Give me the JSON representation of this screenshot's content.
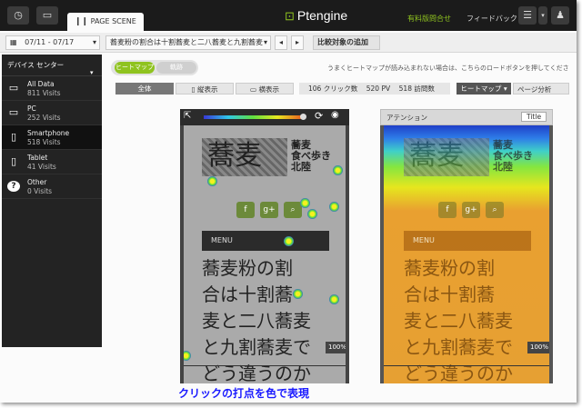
{
  "topbar": {
    "tab_label": "PAGE SCENE",
    "logo_text": "Ptengine",
    "contact_link": "有料版問合せ",
    "feedback_link": "フィードバック"
  },
  "toolbar": {
    "date_range": "07/11 - 07/17",
    "page_title": "蕎麦粉の割合は十割蕎麦と二八蕎麦と九割蕎麦",
    "compare_button": "比較対象の追加"
  },
  "sidebar": {
    "header": "デバイス センター",
    "devices": [
      {
        "name": "All Data",
        "visits": "811 Visits",
        "icon": "monitor-tablet-icon"
      },
      {
        "name": "PC",
        "visits": "252 Visits",
        "icon": "monitor-icon"
      },
      {
        "name": "Smartphone",
        "visits": "518 Visits",
        "icon": "smartphone-icon"
      },
      {
        "name": "Tablet",
        "visits": "41 Visits",
        "icon": "tablet-icon"
      },
      {
        "name": "Other",
        "visits": "0 Visits",
        "icon": "question-icon"
      }
    ]
  },
  "toggle": {
    "heatmap": "ヒートマップ",
    "trace": "軌跡"
  },
  "notice": "うまくヒートマップが読み込まれない場合は、こちらのロードボタンを押してくださ",
  "view": {
    "all": "全体",
    "portrait": "縦表示",
    "landscape": "横表示"
  },
  "stats": {
    "clicks": "106 クリック数",
    "pv": "520 PV",
    "visits": "518 訪問数"
  },
  "right_tabs": {
    "heatmap": "ヒートマップ",
    "page_analysis": "ページ分析"
  },
  "preview": {
    "kanji": "蕎麦",
    "subtitle_1": "蕎麦",
    "subtitle_2": "食べ歩き",
    "subtitle_3": "北陸",
    "menu": "MENU",
    "body_lines": [
      "蕎麦粉の割",
      "合は十割蕎",
      "麦と二八蕎麦",
      "と九割蕎麦で",
      "どう違うのか"
    ],
    "zoom": "100%"
  },
  "heatmap_panel": {
    "label": "アテンション",
    "title_button": "Title",
    "zoom": "100%"
  },
  "caption": "クリックの打点を色で表現",
  "colors": {
    "accent": "#8fc31f",
    "caption": "#1a1aff",
    "dark": "#232323"
  }
}
